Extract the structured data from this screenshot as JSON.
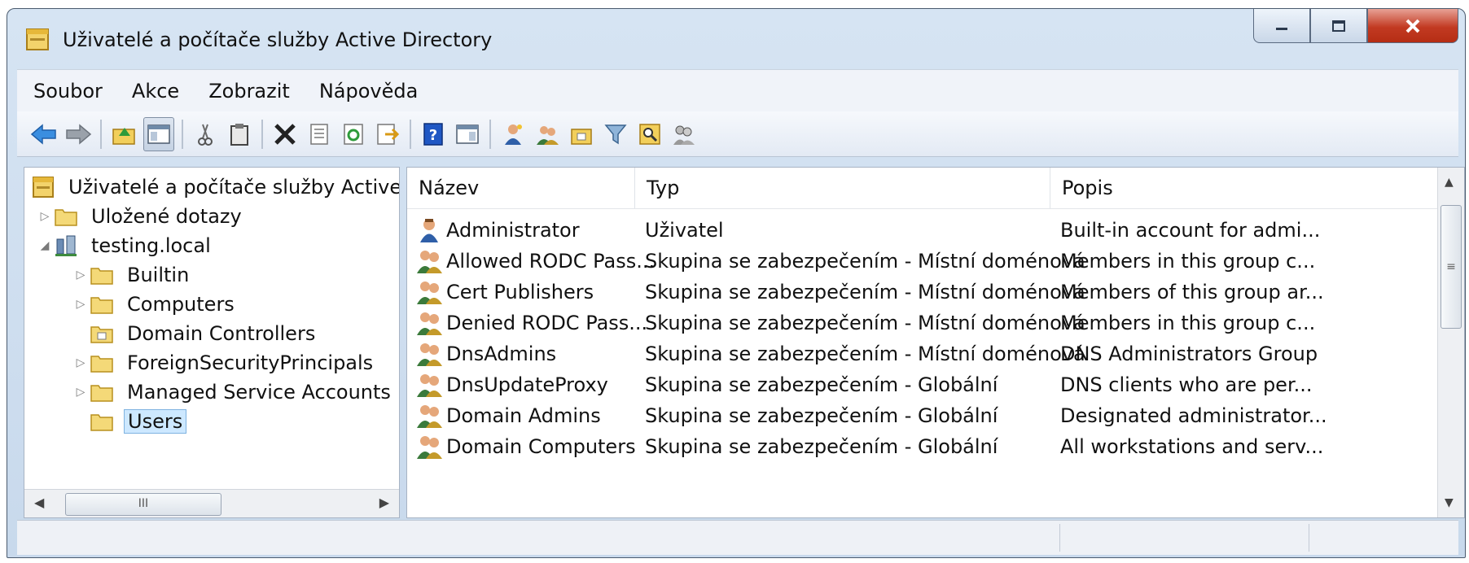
{
  "window": {
    "title": "Uživatelé a počítače služby Active Directory"
  },
  "menu": [
    "Soubor",
    "Akce",
    "Zobrazit",
    "Nápověda"
  ],
  "toolbar": {
    "buttons": [
      "back-icon",
      "forward-icon",
      "up-folder-icon",
      "show-console-tree-icon",
      "cut-icon",
      "paste-icon",
      "delete-icon",
      "properties-icon",
      "refresh-icon",
      "export-list-icon",
      "help-icon",
      "action-pane-icon",
      "new-user-icon",
      "new-group-icon",
      "new-ou-icon",
      "filter-icon",
      "find-icon",
      "add-to-group-icon"
    ]
  },
  "tree": {
    "root": "Uživatelé a počítače služby Active Directory",
    "items": [
      {
        "label": "Uložené dotazy",
        "expander": "collapsed"
      },
      {
        "label": "testing.local",
        "expander": "expanded"
      },
      {
        "label": "Builtin",
        "expander": "collapsed"
      },
      {
        "label": "Computers",
        "expander": "collapsed"
      },
      {
        "label": "Domain Controllers",
        "expander": "none"
      },
      {
        "label": "ForeignSecurityPrincipals",
        "expander": "collapsed"
      },
      {
        "label": "Managed Service Accounts",
        "expander": "collapsed"
      },
      {
        "label": "Users",
        "expander": "none",
        "selected": true
      }
    ],
    "scroll_thumb": "III"
  },
  "list": {
    "columns": [
      "Název",
      "Typ",
      "Popis"
    ],
    "rows": [
      {
        "icon": "user-icon",
        "name": "Administrator",
        "type": "Uživatel",
        "desc": "Built-in account for admi..."
      },
      {
        "icon": "group-icon",
        "name": "Allowed RODC Pass...",
        "type": "Skupina se zabezpečením - Místní doménová",
        "desc": "Members in this group c..."
      },
      {
        "icon": "group-icon",
        "name": "Cert Publishers",
        "type": "Skupina se zabezpečením - Místní doménová",
        "desc": "Members of this group ar..."
      },
      {
        "icon": "group-icon",
        "name": "Denied RODC Pass...",
        "type": "Skupina se zabezpečením - Místní doménová",
        "desc": "Members in this group c..."
      },
      {
        "icon": "group-icon",
        "name": "DnsAdmins",
        "type": "Skupina se zabezpečením - Místní doménová",
        "desc": "DNS Administrators Group"
      },
      {
        "icon": "group-icon",
        "name": "DnsUpdateProxy",
        "type": "Skupina se zabezpečením - Globální",
        "desc": "DNS clients who are per..."
      },
      {
        "icon": "group-icon",
        "name": "Domain Admins",
        "type": "Skupina se zabezpečením - Globální",
        "desc": "Designated administrator..."
      },
      {
        "icon": "group-icon",
        "name": "Domain Computers",
        "type": "Skupina se zabezpečením - Globální",
        "desc": "All workstations and serv..."
      }
    ]
  },
  "colors": {
    "selection": "#cde8ff",
    "close_button": "#c23a22",
    "window_frame": "#c8d9ec"
  }
}
